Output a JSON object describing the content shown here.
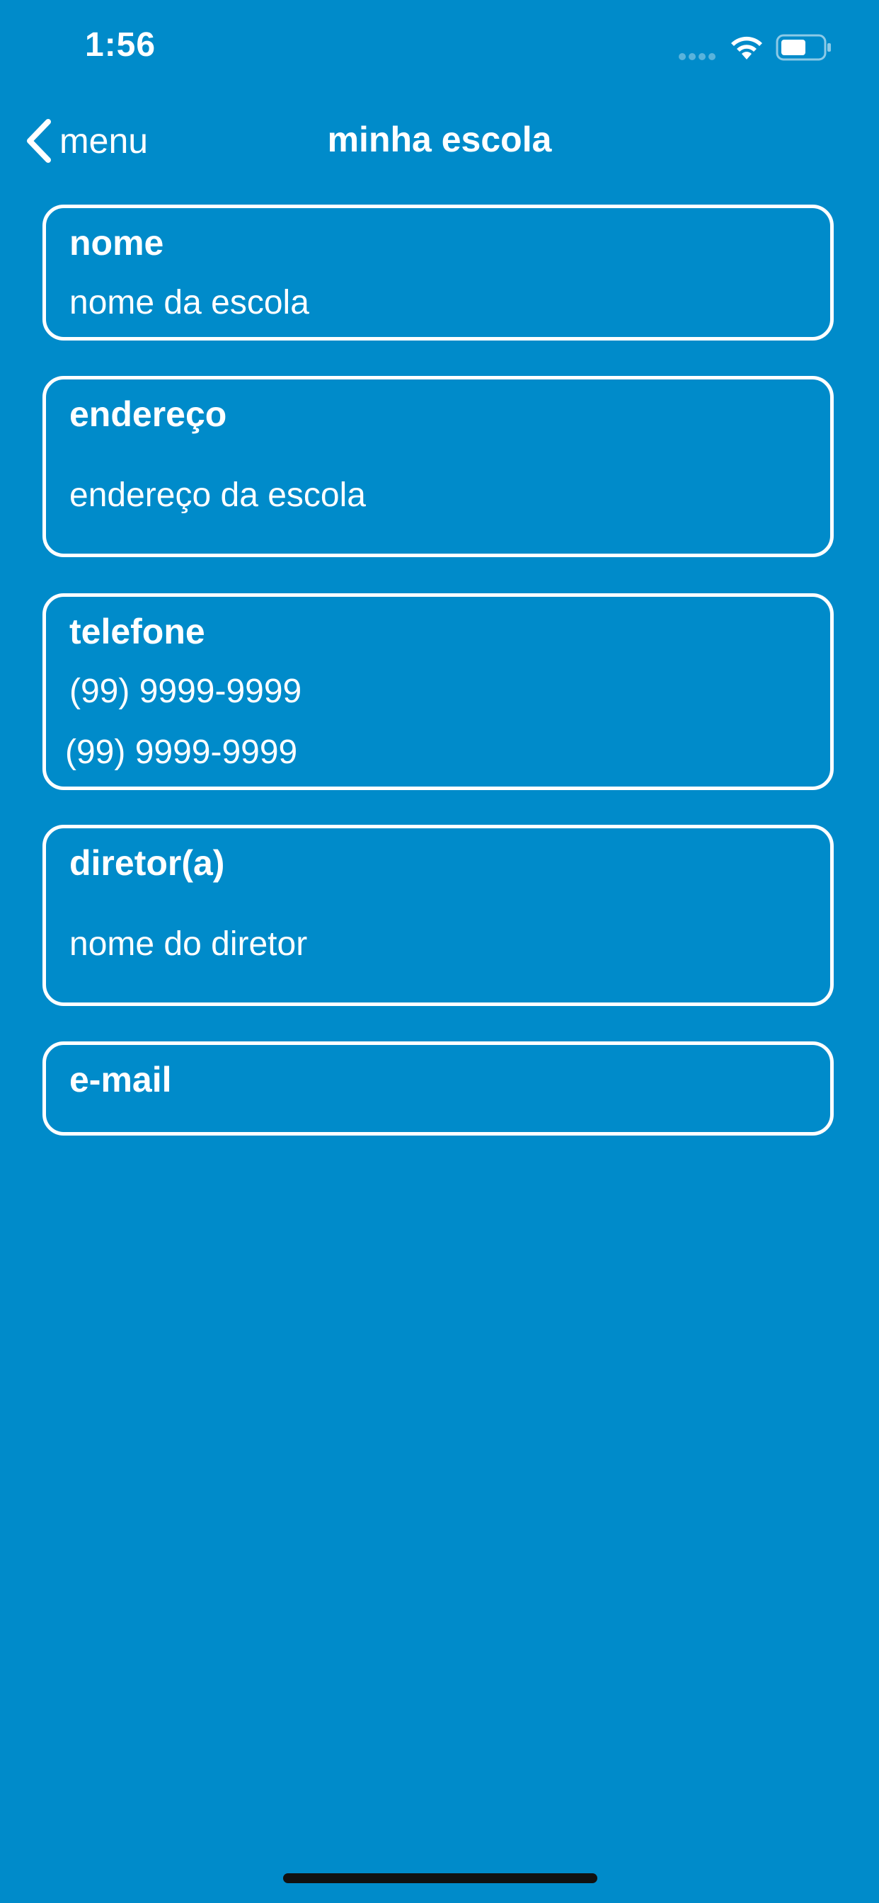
{
  "status_bar": {
    "time": "1:56"
  },
  "nav": {
    "back_label": "menu",
    "title": "minha escola"
  },
  "fields": {
    "nome": {
      "label": "nome",
      "value": "nome da escola"
    },
    "endereco": {
      "label": "endereço",
      "value": "endereço da escola"
    },
    "telefone": {
      "label": "telefone",
      "values": [
        "(99) 9999-9999",
        "(99) 9999-9999"
      ]
    },
    "diretor": {
      "label": "diretor(a)",
      "value": "nome do diretor"
    },
    "email": {
      "label": "e-mail",
      "value": ""
    }
  },
  "colors": {
    "background": "#008BCA",
    "foreground": "#FFFFFF",
    "home_indicator": "#111111"
  }
}
